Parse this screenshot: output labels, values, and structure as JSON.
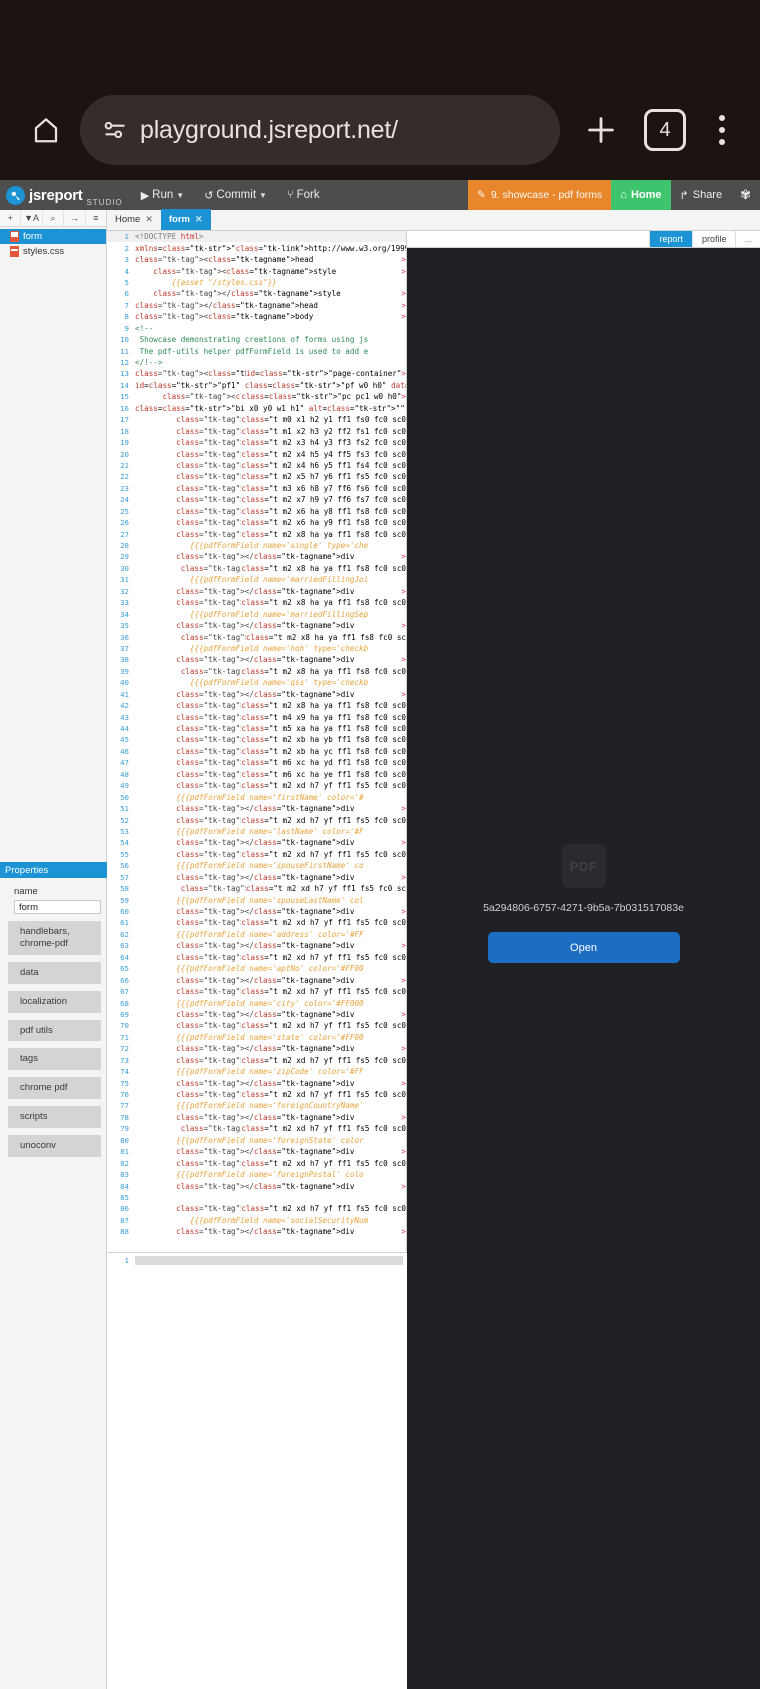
{
  "browser": {
    "home_icon": "home-icon",
    "site_info_icon": "page-info-icon",
    "url": "playground.jsreport.net/",
    "new_tab_icon": "plus-icon",
    "tab_count": "4",
    "menu_icon": "kebab-menu-icon"
  },
  "topbar": {
    "brand": "jsreport",
    "brand_sub": "STUDIO",
    "run_label": "Run",
    "commit_label": "Commit",
    "fork_label": "Fork",
    "entity_label": "9. showcase - pdf forms",
    "home_label": "Home",
    "share_label": "Share",
    "settings_icon": "gear-icon",
    "entity_color": "#e8862b",
    "home_color": "#3ec46d",
    "accent_color": "#1b93d4"
  },
  "sidebar": {
    "toolbar": [
      {
        "name": "add-entity-button",
        "glyph": "+"
      },
      {
        "name": "filter-button",
        "glyph": "▼A"
      },
      {
        "name": "search-button",
        "glyph": "⌕"
      },
      {
        "name": "jump-button",
        "glyph": "→"
      },
      {
        "name": "menu-button",
        "glyph": "≡"
      }
    ],
    "tree": [
      {
        "label": "form",
        "icon": "pdf-file-icon",
        "active": true
      },
      {
        "label": "styles.css",
        "icon": "css-file-icon",
        "active": false
      }
    ],
    "properties": {
      "title": "Properties",
      "name_label": "name",
      "name_value": "form",
      "buttons": [
        "handlebars,\nchrome-pdf",
        "data",
        "localization",
        "pdf utils",
        "tags",
        "chrome pdf",
        "scripts",
        "unoconv"
      ]
    }
  },
  "editor": {
    "tabs": [
      {
        "label": "Home",
        "active": false,
        "closable": true
      },
      {
        "label": "form",
        "active": true,
        "closable": true
      }
    ],
    "first_line_number": 1,
    "stub_line_number": "1",
    "lines": [
      "<!DOCTYPE html>",
      "<html xmlns=\"http://www.w3.org/1999/xhtml\">",
      "<head>",
      "    <style>",
      "        {{asset \"/styles.css\"}}",
      "    </style>",
      "</head>",
      "<body>",
      "<!--",
      " Showcase demonstrating creations of forms using js",
      " The pdf-utils helper pdfFormField is used to add e",
      "</!-->",
      "<div id=\"page-container\">",
      "   <div id=\"pf1\" class=\"pf w0 h0\" data-page-no=\"1\">",
      "      <div class=\"pc pc1 w0 h0\">",
      "         <img class=\"bi x0 y0 w1 h1\" alt=\"\" src=\"da",
      "         <div class=\"t m0 x1 h2 y1 ff1 fs0 fc0 sc0",
      "         <div class=\"t m1 x2 h3 y2 ff2 fs1 fc0 sc0",
      "         <div class=\"t m2 x3 h4 y3 ff3 fs2 fc0 sc0",
      "         <div class=\"t m2 x4 h5 y4 ff5 fs3 fc0 sc0",
      "         <div class=\"t m2 x4 h6 y5 ff1 fs4 fc0 sc0",
      "         <div class=\"t m2 x5 h7 y6 ff1 fs5 fc0 sc0",
      "         <div class=\"t m3 x6 h8 y7 ff6 fs6 fc0 sc0",
      "         <div class=\"t m2 x7 h9 y7 ff6 fs7 fc0 sc0",
      "         <div class=\"t m2 x6 ha y8 ff1 fs8 fc0 sc0",
      "         <div class=\"t m2 x6 ha y9 ff1 fs8 fc0 sc0",
      "         <div class=\"t m2 x8 ha ya ff1 fs8 fc0 sc0",
      "            {{{pdfFormField name='single' type='che",
      "         </div>",
      "          <div class=\"t m2 x8 ha ya ff1 fs8 fc0 sc0",
      "            {{{pdfFormField name='marriedFillingJoi",
      "         </div>",
      "         <div class=\"t m2 x8 ha ya ff1 fs8 fc0 sc0",
      "            {{{pdfFormField name='marriedFillingSep",
      "         </div>",
      "          <div class=\"t m2 x8 ha ya ff1 fs8 fc0 sc",
      "            {{{pdfFormField name='hoh' type='checkb",
      "         </div>",
      "          <div class=\"t m2 x8 ha ya ff1 fs8 fc0 sc0",
      "            {{{pdfFormField name='qss' type='checkb",
      "         </div>",
      "         <div class=\"t m2 x8 ha ya ff1 fs8 fc0 sc0",
      "         <div class=\"t m4 x9 ha ya ff1 fs8 fc0 sc0",
      "         <div class=\"t m5 xa ha ya ff1 fs8 fc0 sc0",
      "         <div class=\"t m2 xb ha yb ff1 fs8 fc0 sc0",
      "         <div class=\"t m2 xb ha yc ff1 fs8 fc0 sc0",
      "         <div class=\"t m6 xc ha yd ff1 fs8 fc0 sc0",
      "         <div class=\"t m6 xc ha ye ff1 fs8 fc0 sc0",
      "         <div class=\"t m2 xd h7 yf ff1 fs5 fc0 sc0",
      "         {{{pdfFormField name='firstName' color='#",
      "         </div>",
      "         <div class=\"t m2 xd h7 yf ff1 fs5 fc0 sc0",
      "         {{{pdfFormField name='lastName' color='#F",
      "         </div>",
      "         <div class=\"t m2 xd h7 yf ff1 fs5 fc0 sc0",
      "         {{{pdfFormField name='spouseFirstName' co",
      "         </div>",
      "          <div class=\"t m2 xd h7 yf ff1 fs5 fc0 sc",
      "         {{{pdfFormField name='spouseLastName' col",
      "         </div>",
      "         <div class=\"t m2 xd h7 yf ff1 fs5 fc0 sc0",
      "         {{{pdfFormField name='address' color='#FF",
      "         </div>",
      "         <div class=\"t m2 xd h7 yf ff1 fs5 fc0 sc0",
      "         {{{pdfFormField name='aptNo' color='#FF00",
      "         </div>",
      "         <div class=\"t m2 xd h7 yf ff1 fs5 fc0 sc0",
      "         {{{pdfFormField name='city' color='#FF000",
      "         </div>",
      "         <div class=\"t m2 xd h7 yf ff1 fs5 fc0 sc0",
      "         {{{pdfFormField name='state' color='#FF00",
      "         </div>",
      "         <div class=\"t m2 xd h7 yf ff1 fs5 fc0 sc0",
      "         {{{pdfFormField name='zipCode' color='#FF",
      "         </div>",
      "         <div class=\"t m2 xd h7 yf ff1 fs5 fc0 sc0",
      "         {{{pdfFormField name='foreignCountryName'",
      "         </div>",
      "          <div class=\"t m2 xd h7 yf ff1 fs5 fc0 sc0",
      "         {{{pdfFormField name='foreignState' color",
      "         </div>",
      "         <div class=\"t m2 xd h7 yf ff1 fs5 fc0 sc0",
      "         {{{pdfFormField name='foreignPostal' colo",
      "         </div>",
      "",
      "         <div class=\"t m2 xd h7 yf ff1 fs5 fc0 sc0",
      "            {{{pdfFormField name='socialSecurityNum",
      "         </div>"
    ]
  },
  "preview": {
    "tabs": [
      {
        "label": "report",
        "active": true
      },
      {
        "label": "profile",
        "active": false
      },
      {
        "label": "...",
        "active": false
      }
    ],
    "file_icon_text": "PDF",
    "file_name": "5a294806-6757-4271-9b5a-7b031517083e",
    "open_label": "Open",
    "open_color": "#1b6ec2",
    "background": "#202124"
  }
}
